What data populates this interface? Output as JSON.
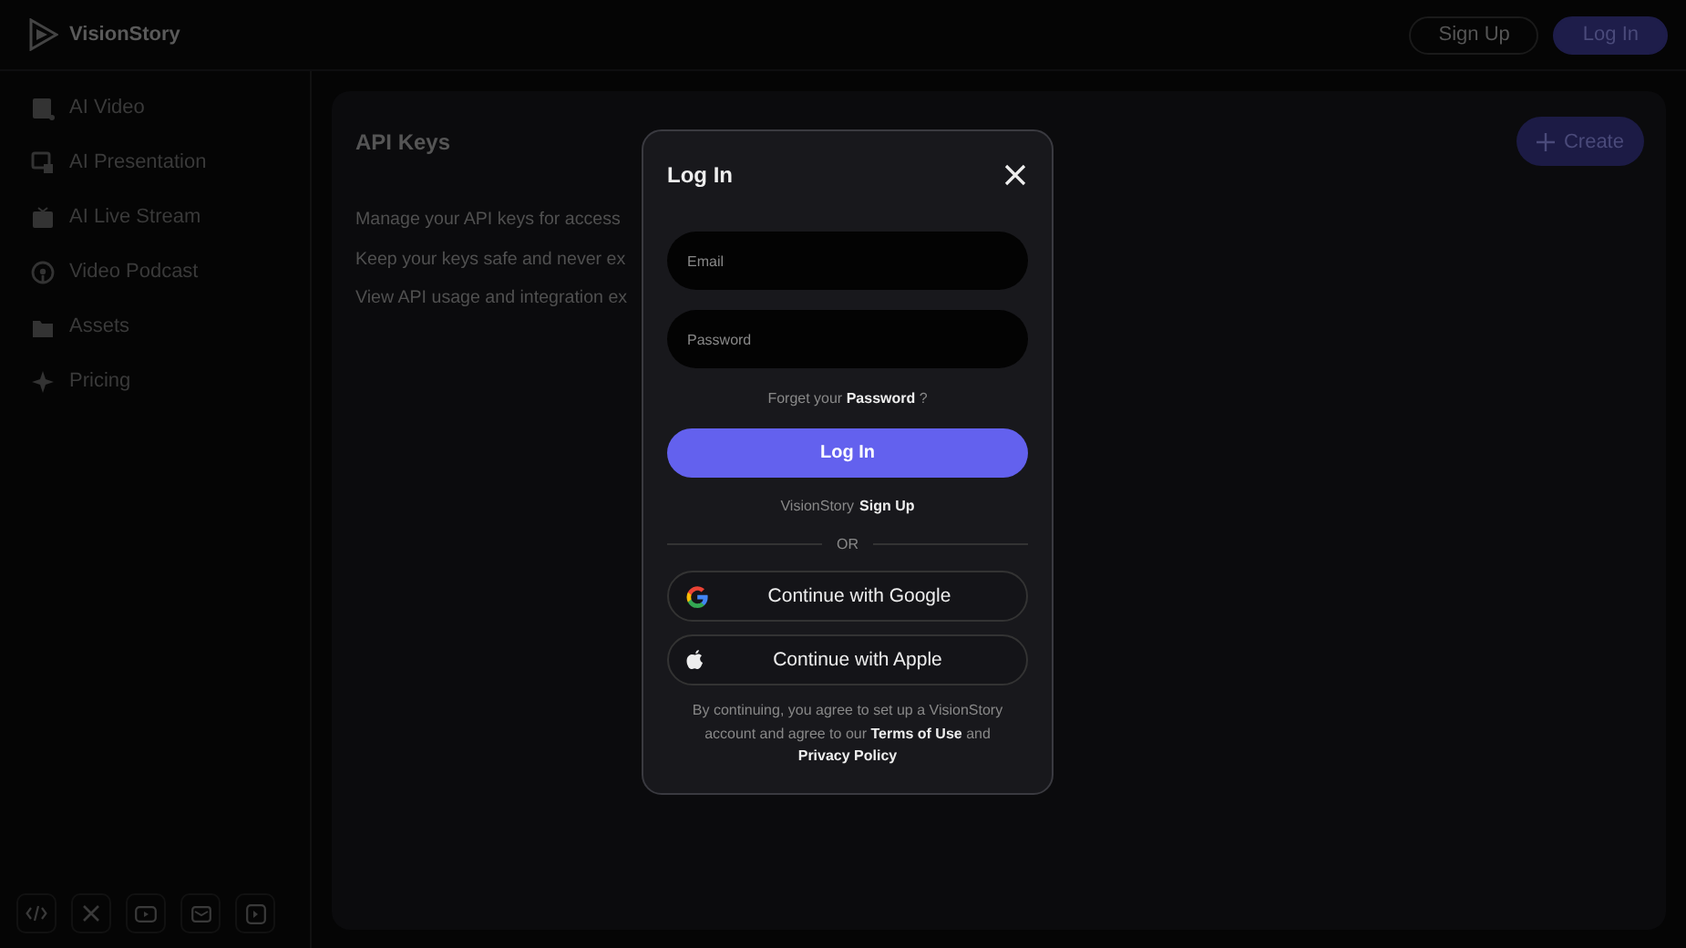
{
  "brand": {
    "name": "VisionStory"
  },
  "header": {
    "buttons": [
      {
        "label": "Sign Up",
        "kind": "outline"
      },
      {
        "label": "Log In",
        "kind": "primary"
      }
    ]
  },
  "sidebar": {
    "items": [
      {
        "label": "AI Video",
        "kind": "video"
      },
      {
        "label": "AI Presentation",
        "kind": "presentation"
      },
      {
        "label": "AI Live Stream",
        "kind": "live"
      },
      {
        "label": "Video Podcast",
        "kind": "podcast"
      },
      {
        "label": "Assets",
        "kind": "folder"
      },
      {
        "label": "Pricing",
        "kind": "sparkle"
      }
    ]
  },
  "main": {
    "title": "API Keys",
    "create_button": "Create",
    "lines": [
      "Manage your API keys for access",
      "Keep your keys safe and never ex",
      "View API usage and integration ex"
    ]
  },
  "dialog": {
    "title": "Log In",
    "email": {
      "placeholder": "Email"
    },
    "password": {
      "placeholder": "Password"
    },
    "forgot": "Forget your **Password** ?",
    "submit": "Log In",
    "signup_text": "VisionStory",
    "signup_link": "Sign Up",
    "divider": "OR",
    "providers": [
      {
        "label": "Continue with Google",
        "kind": "google"
      },
      {
        "label": "Continue with Apple",
        "kind": "apple"
      }
    ],
    "terms_text": "By continuing, you agree to set up a VisionStory account and agree to our",
    "terms_link": "Terms of Use",
    "terms_and": "and",
    "privacy_link": "Privacy Policy"
  }
}
